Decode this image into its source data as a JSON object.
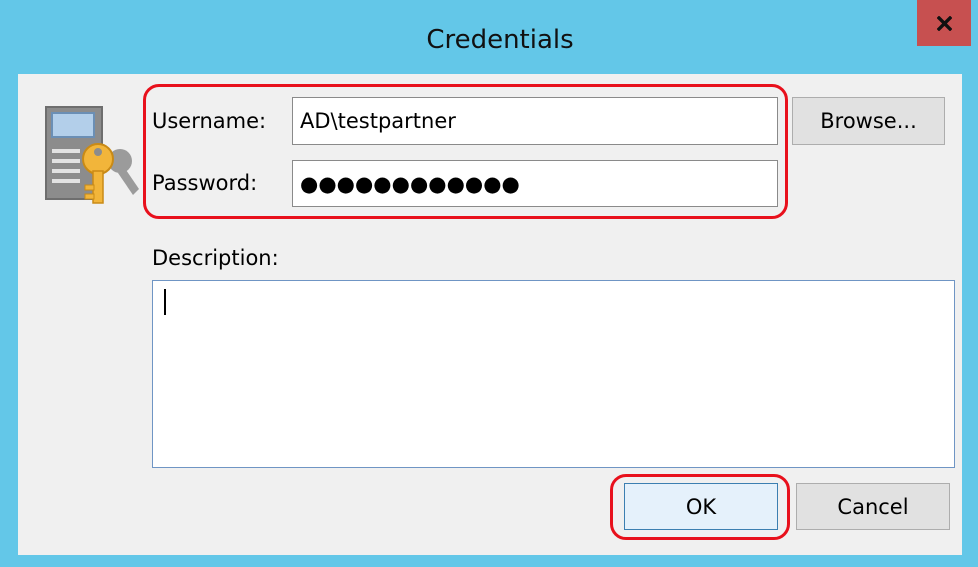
{
  "window": {
    "title": "Credentials"
  },
  "form": {
    "username_label": "Username:",
    "username_value": "AD\\testpartner",
    "password_label": "Password:",
    "password_value": "●●●●●●●●●●●●",
    "browse_label": "Browse...",
    "description_label": "Description:"
  },
  "buttons": {
    "ok_label": "OK",
    "cancel_label": "Cancel"
  },
  "icons": {
    "close": "close-icon",
    "credential": "credential-key-icon"
  },
  "colors": {
    "title_bar": "#63C7E8",
    "close_button": "#C75050",
    "highlight": "#E8101C",
    "content_bg": "#F0F0F0"
  }
}
